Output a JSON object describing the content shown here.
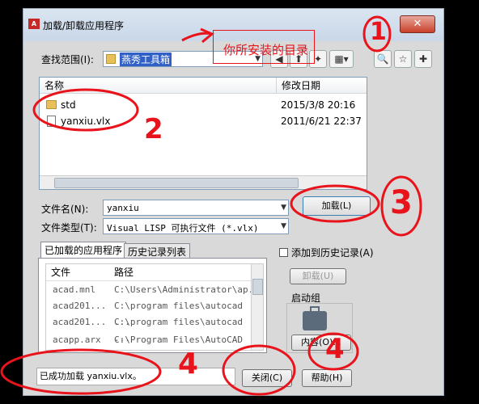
{
  "window": {
    "title": "加载/卸载应用程序",
    "app_icon": "A"
  },
  "lookin": {
    "label": "查找范围(I):",
    "value": "燕秀工具箱"
  },
  "annotation": {
    "install_dir": "你所安装的目录"
  },
  "filelist": {
    "columns": [
      "名称",
      "修改日期"
    ],
    "rows": [
      {
        "name": "std",
        "date": "2015/3/8 20:16",
        "icon": "folder-icon"
      },
      {
        "name": "yanxiu.vlx",
        "date": "2011/6/21 22:37",
        "icon": "file-icon"
      }
    ]
  },
  "filename": {
    "label": "文件名(N):",
    "value": "yanxiu"
  },
  "filetype": {
    "label": "文件类型(T):",
    "value": "Visual LISP 可执行文件 (*.vlx)"
  },
  "load_button": "加载(L)",
  "tabs": [
    "已加载的应用程序",
    "历史记录列表"
  ],
  "loaded_table": {
    "columns": [
      "文件",
      "路径"
    ],
    "rows": [
      {
        "file": "acad.mnl",
        "path": "C:\\Users\\Administrator\\ap..."
      },
      {
        "file": "acad201...",
        "path": "C:\\program files\\autocad ..."
      },
      {
        "file": "acad201...",
        "path": "C:\\program files\\autocad ..."
      },
      {
        "file": "acapp.arx",
        "path": "C:\\Program Files\\AutoCAD ..."
      }
    ]
  },
  "history_checkbox": "添加到历史记录(A)",
  "unload_button": "卸载(U)",
  "startup_group": {
    "label": "启动组",
    "icon": "briefcase-icon",
    "contents_button": "内容(O)..."
  },
  "status_text": "已成功加载 yanxiu.vlx。",
  "close_button": "关闭(C)",
  "help_button": "帮助(H)",
  "annotation_numbers": [
    "1",
    "2",
    "3",
    "4",
    "4"
  ],
  "colors": {
    "annotation": "#e8131b",
    "dialog_bg": "#d9d9d9"
  }
}
